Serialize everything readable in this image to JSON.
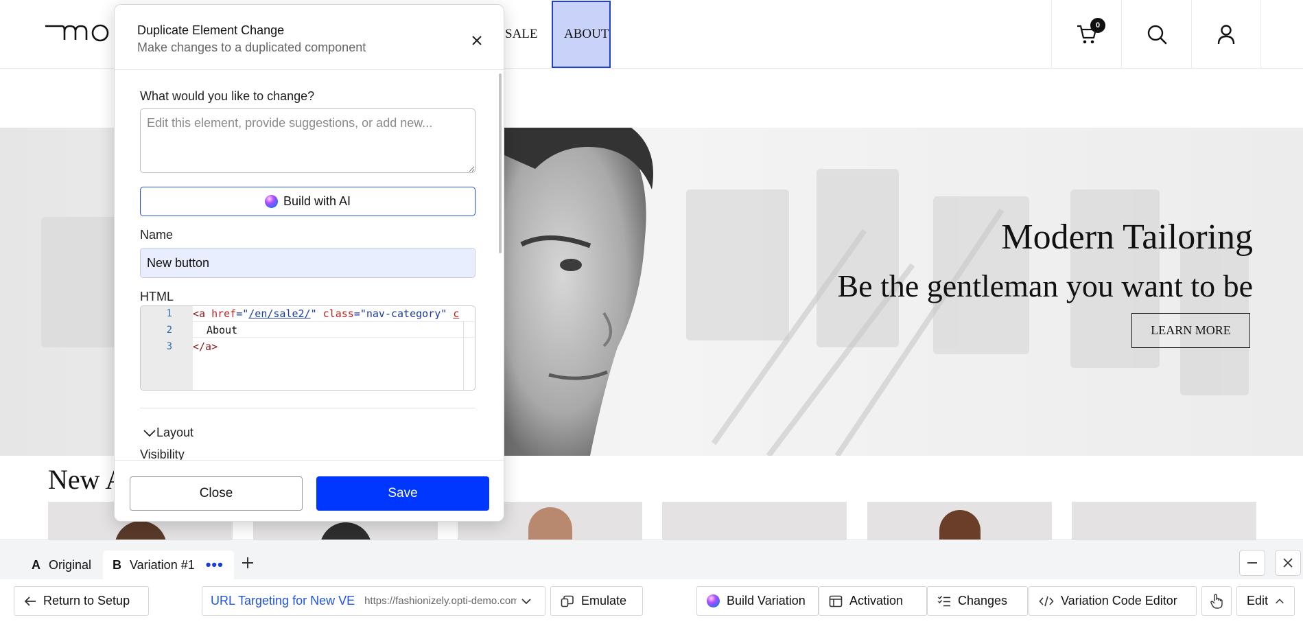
{
  "site": {
    "brand": "mo",
    "nav": {
      "sale": "SALE",
      "about": "ABOUT"
    },
    "cart_count": "0",
    "icons": [
      "cart-icon",
      "search-icon",
      "account-icon"
    ]
  },
  "hero": {
    "title": "Modern Tailoring",
    "subtitle": "Be the gentleman you want to be",
    "cta": "LEARN MORE"
  },
  "new_arrivals": {
    "title": "New A"
  },
  "modal": {
    "title": "Duplicate Element Change",
    "subtitle": "Make changes to a duplicated component",
    "change_label": "What would you like to change?",
    "change_placeholder": "Edit this element, provide suggestions, or add new...",
    "build_ai_label": "Build with AI",
    "name_label": "Name",
    "name_value": "New button",
    "html_label": "HTML",
    "code": {
      "line_numbers": [
        "1",
        "2",
        "3"
      ],
      "line1": {
        "open": "<a ",
        "href_attr": "href",
        "eq1": "=\"",
        "href_val": "/en/sale2/",
        "q1": "\" ",
        "class_attr": "class",
        "eq2": "=\"",
        "class_val": "nav-category",
        "q2": "\" ",
        "tail": "c"
      },
      "line2": "About",
      "line3": "</a>"
    },
    "layout_label": "Layout",
    "visibility_label": "Visibility",
    "close_label": "Close",
    "save_label": "Save"
  },
  "editor": {
    "tabs": [
      {
        "letter": "A",
        "label": "Original"
      },
      {
        "letter": "B",
        "label": "Variation #1",
        "menu": "•••"
      }
    ],
    "toolbar": {
      "return_label": "Return to Setup",
      "url_target_label": "URL Targeting for New VE",
      "url_target_url": "https://fashionizely.opti-demo.com",
      "emulate_label": "Emulate",
      "build_variation_label": "Build Variation",
      "activation_label": "Activation",
      "changes_label": "Changes",
      "code_editor_label": "Variation Code Editor",
      "edit_label": "Edit"
    }
  },
  "colors": {
    "accent_blue": "#0037ff",
    "link_blue": "#1f52e0",
    "selection_fill": "#c9d3fa",
    "selection_border": "#1f3fd1"
  }
}
